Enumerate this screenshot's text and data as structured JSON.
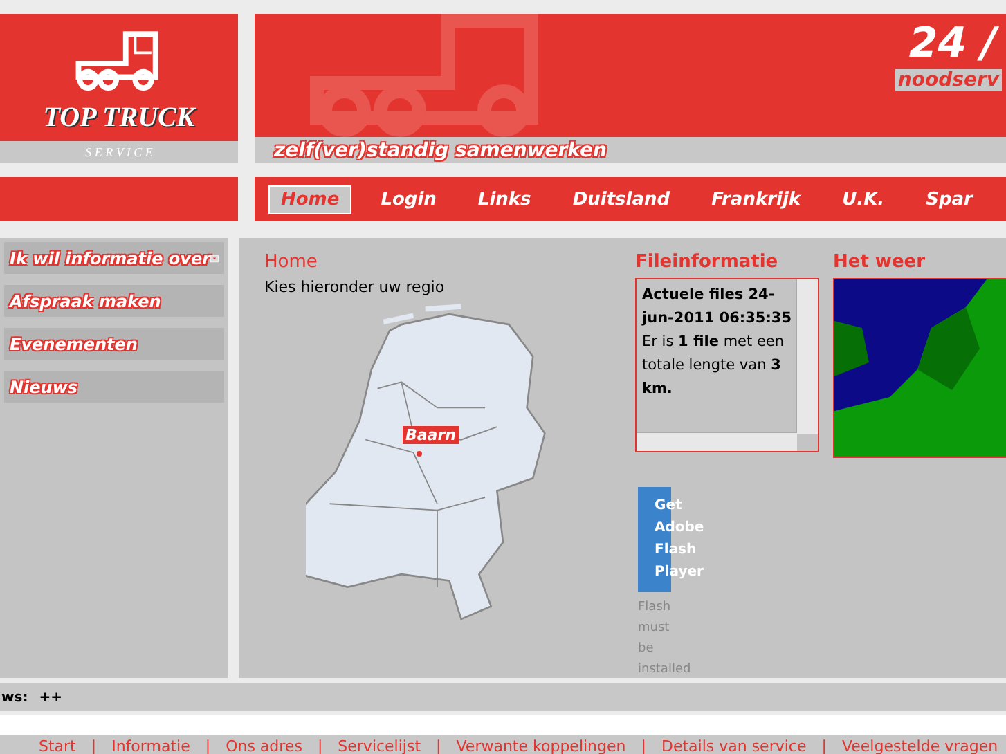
{
  "logo": {
    "title": "TOP TRUCK",
    "subtitle": "S E R V I C E"
  },
  "banner": {
    "slogan": "zelf(ver)standig samenwerken",
    "hours": "24 /",
    "emergency": "noodserv"
  },
  "nav": [
    {
      "label": "Home",
      "selected": true
    },
    {
      "label": "Login",
      "selected": false
    },
    {
      "label": "Links",
      "selected": false
    },
    {
      "label": "Duitsland",
      "selected": false
    },
    {
      "label": "Frankrijk",
      "selected": false
    },
    {
      "label": "U.K.",
      "selected": false
    },
    {
      "label": "Spar",
      "selected": false
    }
  ],
  "sidebar": [
    {
      "label": "Ik wil informatie over",
      "kind": "dropdown"
    },
    {
      "label": "Afspraak maken",
      "kind": "link"
    },
    {
      "label": "Evenementen",
      "kind": "link"
    },
    {
      "label": "Nieuws",
      "kind": "link"
    }
  ],
  "home": {
    "heading": "Home",
    "subtitle": "Kies hieronder uw regio",
    "map_label": "Baarn"
  },
  "traffic": {
    "heading": "Fileinformatie",
    "title": "Actuele files 24-jun-2011 06:35:35",
    "text": "Er is **1 file** met een totale lengte van **3 km.**"
  },
  "weather": {
    "heading": "Het weer"
  },
  "flash": {
    "button": "Get Adobe Flash Player",
    "note": "Flash must be installed"
  },
  "ticker": {
    "label": "ws:",
    "text": "++"
  },
  "footer": {
    "separator": "|",
    "links": [
      "Start",
      "Informatie",
      "Ons adres",
      "Servicelijst",
      "Verwante koppelingen",
      "Details van service",
      "Veelgestelde vragen"
    ]
  }
}
